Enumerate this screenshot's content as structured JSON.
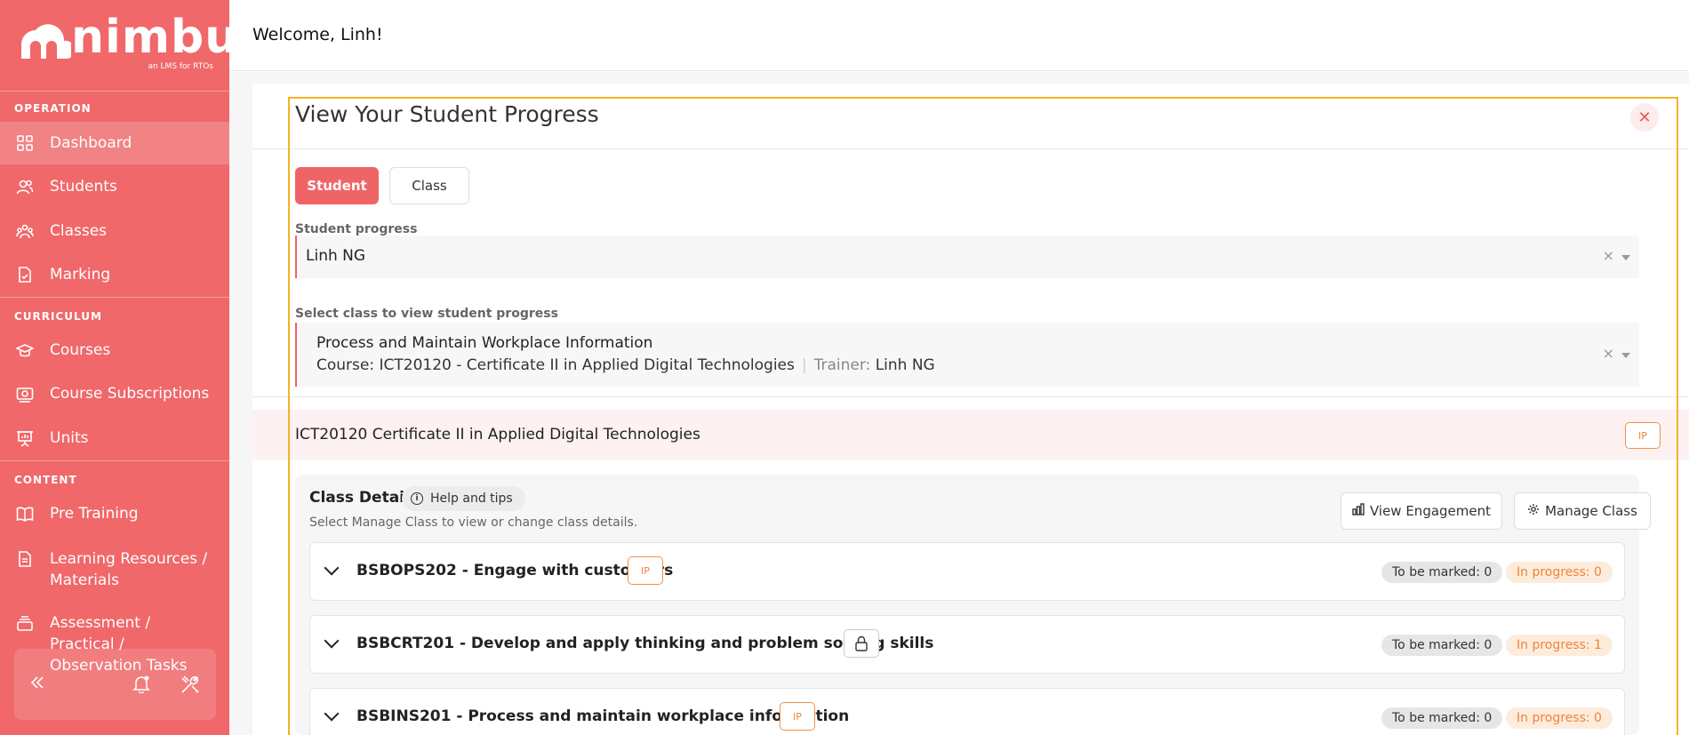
{
  "brand": {
    "name": "nimbu",
    "tagline": "an LMS for RTOs"
  },
  "sidebar": {
    "sections": [
      {
        "title": "OPERATION"
      },
      {
        "title": "CURRICULUM"
      },
      {
        "title": "CONTENT"
      }
    ],
    "items": [
      {
        "label": "Dashboard",
        "icon": "grid-icon",
        "active": true
      },
      {
        "label": "Students",
        "icon": "users-icon"
      },
      {
        "label": "Classes",
        "icon": "group-icon"
      },
      {
        "label": "Marking",
        "icon": "document-check-icon"
      },
      {
        "label": "Courses",
        "icon": "graduation-cap-icon"
      },
      {
        "label": "Course Subscriptions",
        "icon": "subscription-icon"
      },
      {
        "label": "Units",
        "icon": "presentation-icon"
      },
      {
        "label": "Pre Training",
        "icon": "book-icon"
      },
      {
        "label": "Learning Resources / Materials",
        "icon": "file-icon"
      },
      {
        "label": "Assessment / Practical / Observation Tasks",
        "icon": "stack-icon"
      }
    ],
    "footer_icons": [
      "collapse-icon",
      "bell-icon",
      "tools-icon"
    ]
  },
  "header": {
    "welcome": "Welcome, Linh!"
  },
  "panel": {
    "title": "View Your Student Progress",
    "close_symbol": "✕",
    "toggle": {
      "student": "Student",
      "class": "Class",
      "selected": "Student"
    },
    "student_label": "Student progress",
    "student_value": "Linh NG",
    "class_label": "Select class to view student progress",
    "class_value": {
      "name": "Process and Maintain Workplace Information",
      "course": "Course: ICT20120 - Certificate II in Applied Digital Technologies",
      "trainer_label": "Trainer:",
      "trainer": "Linh NG"
    },
    "clear_symbol": "×"
  },
  "course": {
    "name": "ICT20120  Certificate II in Applied Digital Technologies",
    "badge": "IP"
  },
  "class_details": {
    "title": "Class Details",
    "help": "Help and tips",
    "subtitle": "Select Manage Class to view or change class details.",
    "view_engagement": "View Engagement",
    "manage_class": "Manage Class"
  },
  "units": [
    {
      "name": "BSBOPS202 - Engage with customers",
      "badge": "IP",
      "to_be_marked": "To be marked: 0",
      "in_progress": "In progress: 0"
    },
    {
      "name": "BSBCRT201 - Develop and apply thinking and problem solving skills",
      "badge": "lock",
      "to_be_marked": "To be marked: 0",
      "in_progress": "In progress: 1"
    },
    {
      "name": "BSBINS201 - Process and maintain workplace information",
      "badge": "IP",
      "to_be_marked": "To be marked: 0",
      "in_progress": "In progress: 0"
    }
  ],
  "colors": {
    "brand": "#f0686a",
    "accent_orange": "#f08338",
    "focus_outline": "#f5b324"
  }
}
